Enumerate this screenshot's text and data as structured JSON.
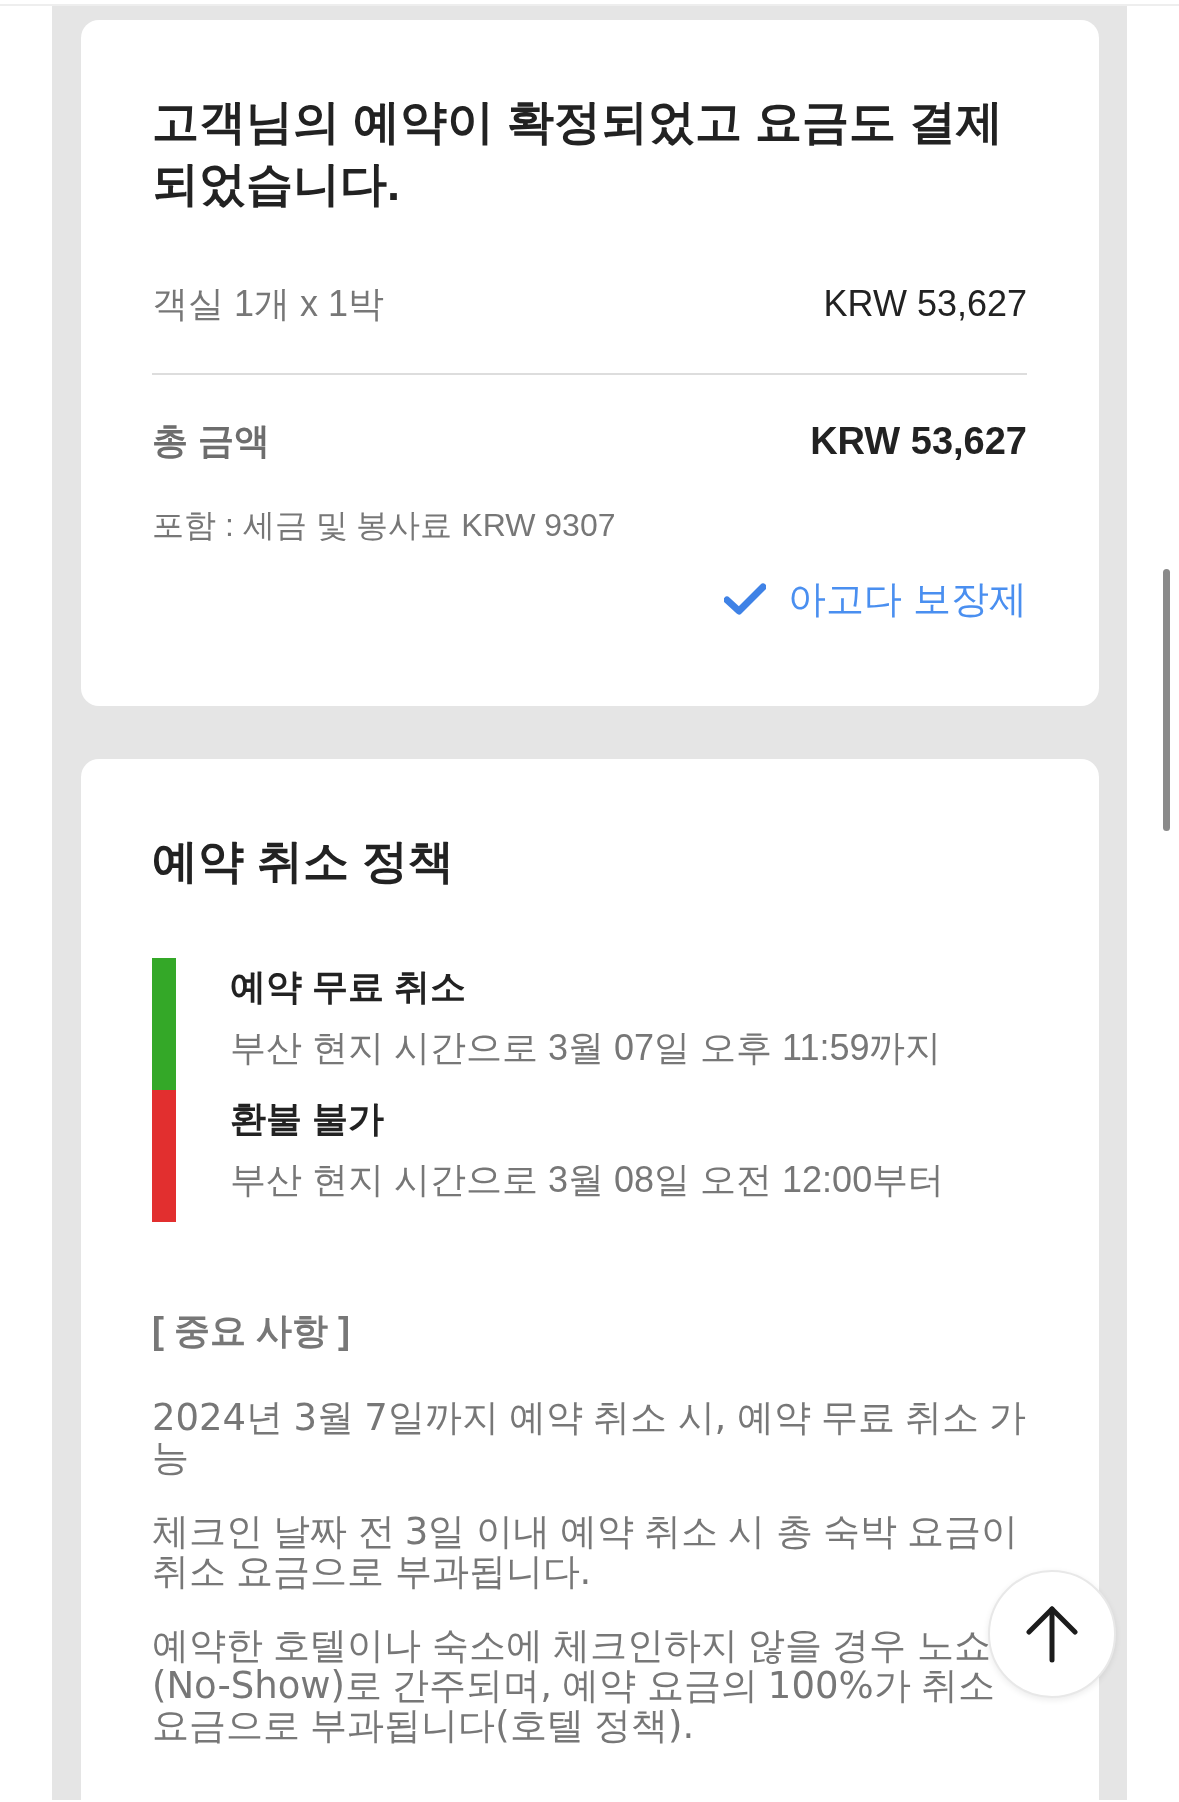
{
  "confirmation_card": {
    "title": "고객님의 예약이 확정되었고 요금도 결제되었습니다.",
    "room_line": {
      "label": "객실 1개 x 1박",
      "amount": "KRW 53,627"
    },
    "total_line": {
      "label": "총 금액",
      "amount": "KRW 53,627"
    },
    "tax_note": "포함 : 세금 및 봉사료 KRW 9307",
    "guarantee_link": "아고다 보장제"
  },
  "policy_card": {
    "title": "예약 취소 정책",
    "timeline": [
      {
        "title": "예약 무료 취소",
        "detail": "부산 현지 시간으로 3월 07일 오후 11:59까지",
        "color": "#34a828"
      },
      {
        "title": "환불 불가",
        "detail": "부산 현지 시간으로 3월 08일 오전 12:00부터",
        "color": "#e22f2f"
      }
    ],
    "notes_heading": "[ 중요 사항 ]",
    "notes": [
      "2024년 3월 7일까지 예약 취소 시, 예약 무료 취소 가능",
      "체크인 날짜 전 3일 이내 예약 취소 시 총 숙박 요금이 취소 요금으로 부과됩니다.",
      "예약한 호텔이나 숙소에 체크인하지 않을 경우 노쇼(No-Show)로 간주되며, 예약 요금의 100%가 취소 요금으로 부과됩니다(호텔 정책)."
    ]
  }
}
